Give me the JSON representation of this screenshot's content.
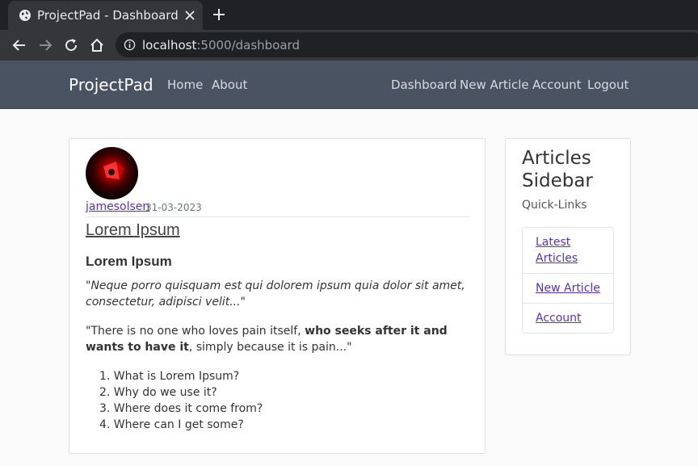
{
  "browser": {
    "tab_title": "ProjectPad - Dashboard",
    "url_host": "localhost",
    "url_rest": ":5000/dashboard"
  },
  "nav": {
    "brand": "ProjectPad",
    "left_links": [
      "Home",
      "About"
    ],
    "right_links": [
      "Dashboard",
      "New Article",
      "Account",
      "Logout"
    ]
  },
  "post": {
    "author": "jamesolsen",
    "date": "31-03-2023",
    "title": "Lorem Ipsum",
    "heading": "Lorem Ipsum",
    "quote": "\"Neque porro quisquam est qui dolorem ipsum quia dolor sit amet, consectetur, adipisci velit...\"",
    "para_start": "\"There is no one who loves pain itself, ",
    "para_bold": "who seeks after it and wants to have it",
    "para_end": ", simply because it is pain...\"",
    "list": [
      "1. What is Lorem Ipsum?",
      "2. Why do we use it?",
      "3. Where does it come from?",
      "4. Where can I get some?"
    ]
  },
  "sidebar": {
    "title": "Articles Sidebar",
    "subtitle": "Quick-Links",
    "links": [
      "Latest Articles",
      "New Article",
      "Account"
    ]
  },
  "icons": {
    "tab": "globe-icon",
    "close": "close-icon",
    "new_tab": "plus-icon",
    "back": "back-arrow-icon",
    "forward": "forward-arrow-icon",
    "reload": "reload-icon",
    "home": "home-icon",
    "info": "info-icon"
  },
  "colors": {
    "navbar": "#4a5361",
    "link": "#5a2fc2",
    "browser_bg": "#202124",
    "browser_toolbar": "#35363a"
  }
}
